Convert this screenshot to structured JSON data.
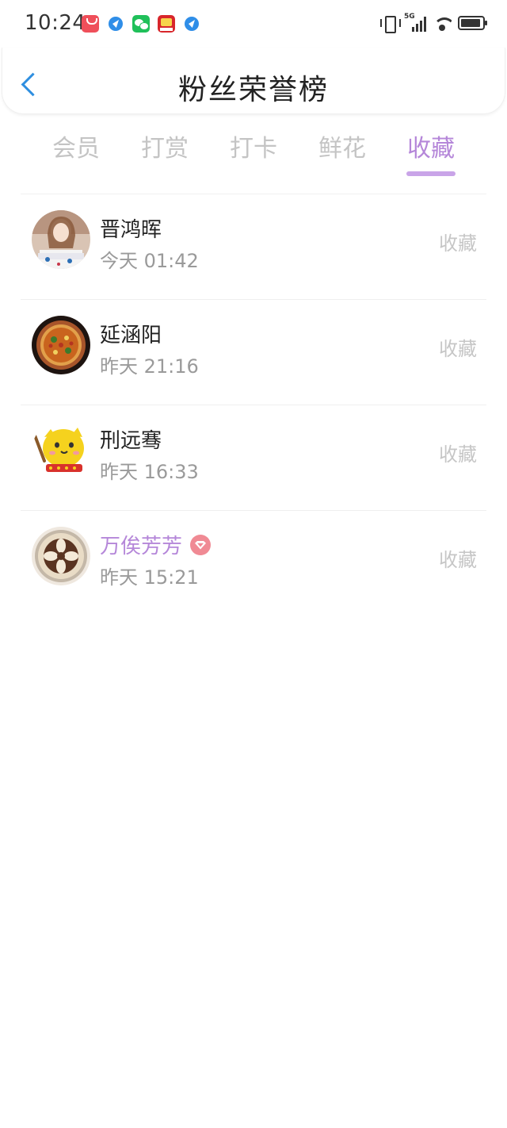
{
  "status_bar": {
    "time": "10:24",
    "network_label": "5G",
    "notification_icons": [
      "shopping-bag-icon",
      "compass-icon",
      "wechat-icon",
      "taobao-icon",
      "compass-icon"
    ]
  },
  "header": {
    "title": "粉丝荣誉榜"
  },
  "tabs": [
    {
      "label": "会员",
      "active": false
    },
    {
      "label": "打赏",
      "active": false
    },
    {
      "label": "打卡",
      "active": false
    },
    {
      "label": "鲜花",
      "active": false
    },
    {
      "label": "收藏",
      "active": true
    }
  ],
  "fans": [
    {
      "name": "晋鸿晖",
      "time": "今天 01:42",
      "action": "收藏",
      "vip": false
    },
    {
      "name": "延涵阳",
      "time": "昨天 21:16",
      "action": "收藏",
      "vip": false
    },
    {
      "name": "刑远骞",
      "time": "昨天 16:33",
      "action": "收藏",
      "vip": false
    },
    {
      "name": "万俟芳芳",
      "time": "昨天 15:21",
      "action": "收藏",
      "vip": true
    }
  ],
  "colors": {
    "accent": "#b587d9",
    "tab_underline": "#c9a4e8",
    "back_arrow": "#2f8fe0",
    "inactive_tab": "#c4c4c4",
    "vip_badge": "#f08a94"
  }
}
